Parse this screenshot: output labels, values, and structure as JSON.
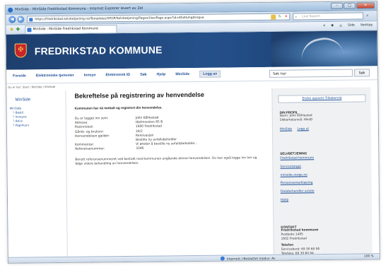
{
  "window": {
    "title": "MinSide - MinSide Fredrikstad Kommune - Internet Explorer levert av ZeI",
    "minimize": "–",
    "maximize": "□",
    "close": "✕"
  },
  "address": {
    "url": "https://fredrikstad.selvbetjening.no/Templates/SFDP/Selvbetjening/Pages/UserPage.aspx?id=85#&lngdsngua",
    "live_search_placeholder": "Live Search"
  },
  "tab": {
    "label": "MinSide - MinSide Fredrikstad Kommune"
  },
  "tools": [
    "Side",
    "Verktøy"
  ],
  "site": {
    "name": "FREDRIKSTAD KOMMUNE"
  },
  "nav": {
    "items": [
      "Forside",
      "Elektroniske tjenester",
      "Innsyn",
      "Elektronisk ID",
      "Søk",
      "Hjelp",
      "MinSide",
      "Logg av"
    ],
    "search_value": "Søk her",
    "search_button": "Søk"
  },
  "breadcrumb": "Du er her: Start / MinSide / MinSide",
  "left": {
    "title": "MinSide",
    "items": [
      {
        "label": "MinSide",
        "sub": false
      },
      {
        "label": "Bestil",
        "sub": true
      },
      {
        "label": "Innsyns",
        "sub": true
      },
      {
        "label": "Arkiv",
        "sub": true
      },
      {
        "label": "Papirkurv",
        "sub": true
      }
    ]
  },
  "main": {
    "heading": "Bekreftelse på registrering av henvendelse",
    "lead": "Kommunen har nå mottatt og registrert din henvendelse.",
    "rows": [
      {
        "k": "Du er logget inn som:",
        "v": "John Kåhlestad"
      },
      {
        "k": "Adresse:",
        "v": "Hjelmsveien 85 B"
      },
      {
        "k": "Postnr/sted:",
        "v": "1600 Fredrikstad"
      },
      {
        "k": "Gårds- og bruksnr:",
        "v": "34/2"
      },
      {
        "k": "Henvendelsen gjelder:",
        "v": "Renovasjon"
      },
      {
        "k": "",
        "v": "Bestille ny avfallsbeholder"
      },
      {
        "k": "Kommentar:",
        "v": "Vi ønsker å bestille ny avfallsbeholder..."
      },
      {
        "k": "Referansenummer:",
        "v": "3346"
      }
    ],
    "closing": "Benytt referansenummeret ved kontakt med kommunen angående denne henvendelsen. Du kan også logge inn her og følge videre behandling av henvendelsen."
  },
  "right": {
    "top_link": "Endre oppsett Tilbakemld",
    "profile": {
      "heading": "DIN PROFIL",
      "lines": [
        "Navn: John Kåhlestad",
        "Sikkerhetsnivå: MinID"
      ],
      "links": [
        "MinSide",
        "Logg ut"
      ]
    },
    "services": {
      "heading": "SELVBETJENING",
      "links": [
        "Fredrikstad kommune",
        "Servicetorget",
        "minside.norge.no",
        "Personvernerklæring",
        "Databehandler avtale",
        "Hjelp"
      ]
    },
    "contact": {
      "heading": "KONTAKT",
      "org": "Fredrikstad kommune",
      "lines": [
        "Postboks 1405",
        "1602 Fredrikstad"
      ],
      "phone_heading": "Telefon",
      "phone_lines": [
        "Servicebord: 69 30 60 00",
        "Telefaks: 69 30 60 04"
      ]
    }
  },
  "status": {
    "zone": "Internett | Beskyttet modus: Av",
    "zoom": "100 %"
  }
}
